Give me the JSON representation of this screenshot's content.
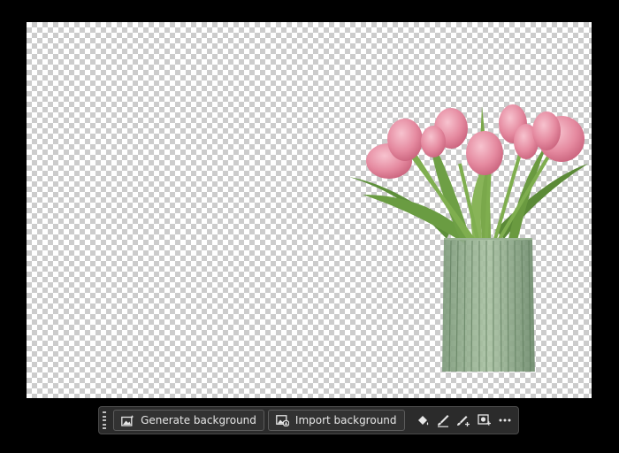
{
  "taskbar": {
    "generate_label": "Generate background",
    "import_label": "Import background",
    "icons": [
      "paint-bucket-icon",
      "brush-icon",
      "brush-add-icon",
      "mask-icon",
      "more-icon"
    ]
  },
  "colors": {
    "background": "#000000",
    "toolbar_bg": "#2b2b2b",
    "toolbar_border": "#4a4a4a",
    "text": "#e6e6e6"
  }
}
